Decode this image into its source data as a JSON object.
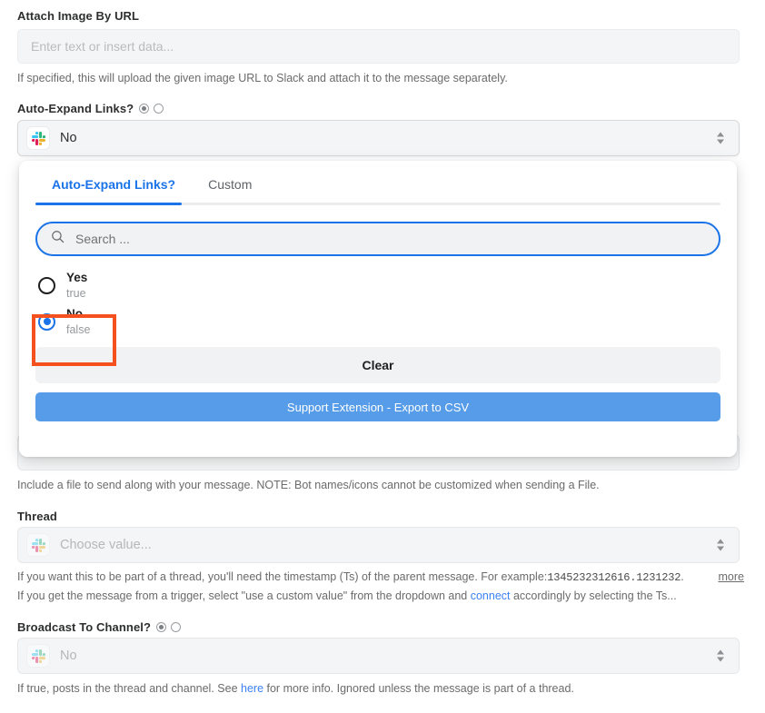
{
  "form": {
    "attach_image": {
      "label": "Attach Image By URL",
      "placeholder": "Enter text or insert data...",
      "help": "If specified, this will upload the given image URL to Slack and attach it to the message separately."
    },
    "auto_expand": {
      "label": "Auto-Expand Links?",
      "value": "No",
      "icon": "slack-icon"
    },
    "file_help": "Include a file to send along with your message. NOTE: Bot names/icons cannot be customized when sending a File.",
    "thread": {
      "label": "Thread",
      "placeholder": "Choose value...",
      "help_line1_a": "If you want this to be part of a thread, you'll need the timestamp (Ts) of the parent message. For example: ",
      "help_line1_code": "1345232312616.1231232",
      "help_line1_b": ".",
      "more_label": "more",
      "help_line2_a": "If you get the message from a trigger, select \"use a custom value\" from the dropdown and ",
      "help_line2_link": "connect",
      "help_line2_b": " accordingly by selecting the Ts..."
    },
    "broadcast": {
      "label": "Broadcast To Channel?",
      "value": "No",
      "help_a": "If true, posts in the thread and channel. See ",
      "help_link": "here",
      "help_b": " for more info. Ignored unless the message is part of a thread."
    }
  },
  "dropdown": {
    "tabs": [
      {
        "label": "Auto-Expand Links?",
        "active": true
      },
      {
        "label": "Custom",
        "active": false
      }
    ],
    "search": {
      "placeholder": "Search ...",
      "icon": "search-icon"
    },
    "options": [
      {
        "title": "Yes",
        "sub": "true",
        "checked": false
      },
      {
        "title": "No",
        "sub": "false",
        "checked": true
      }
    ],
    "clear_label": "Clear",
    "csv_label": "Support Extension - Export to CSV"
  },
  "colors": {
    "accent_blue": "#1a73e8",
    "csv_blue": "#569ce8",
    "highlight_orange": "#f4511e",
    "link_blue": "#3b82f6",
    "field_bg": "#f4f5f6"
  }
}
